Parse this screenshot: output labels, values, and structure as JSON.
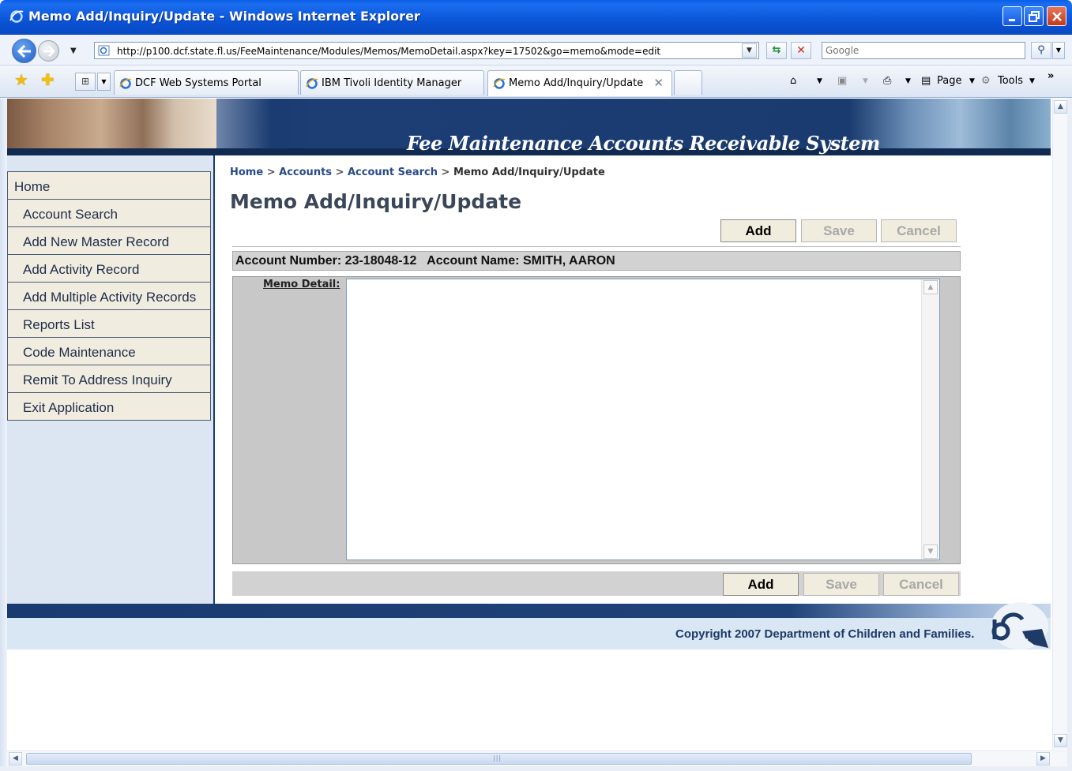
{
  "window": {
    "title": "Memo Add/Inquiry/Update - Windows Internet Explorer"
  },
  "address_bar": {
    "url": "http://p100.dcf.state.fl.us/FeeMaintenance/Modules/Memos/MemoDetail.aspx?key=17502&go=memo&mode=edit",
    "search_placeholder": "Google"
  },
  "tabs": [
    {
      "label": "DCF Web Systems Portal"
    },
    {
      "label": "IBM Tivoli Identity Manager"
    },
    {
      "label": "Memo Add/Inquiry/Update",
      "active": true
    }
  ],
  "command_bar": {
    "page_label": "Page",
    "tools_label": "Tools",
    "overflow": "»"
  },
  "banner": {
    "system_title": "Fee Maintenance Accounts Receivable System"
  },
  "nav": {
    "items": [
      {
        "label": "Home"
      },
      {
        "label": "Account Search"
      },
      {
        "label": "Add New Master Record"
      },
      {
        "label": "Add Activity Record"
      },
      {
        "label": "Add Multiple Activity Records"
      },
      {
        "label": "Reports List"
      },
      {
        "label": "Code Maintenance"
      },
      {
        "label": "Remit To Address Inquiry"
      },
      {
        "label": "Exit Application"
      }
    ]
  },
  "breadcrumb": {
    "items": [
      "Home",
      "Accounts",
      "Account Search"
    ],
    "separator": ">",
    "current": "Memo Add/Inquiry/Update"
  },
  "page": {
    "title": "Memo Add/Inquiry/Update"
  },
  "buttons": {
    "add": "Add",
    "save": "Save",
    "cancel": "Cancel"
  },
  "account": {
    "text": "Account Number: 23-18048-12   Account Name: SMITH, AARON"
  },
  "memo": {
    "label": "Memo Detail:",
    "value": ""
  },
  "footer": {
    "copyright": "Copyright 2007 Department of Children and Families."
  },
  "colors": {
    "banner": "#1c3e75",
    "nav_item_bg": "#f1ece0",
    "nav_bg": "#dbe6f2",
    "title_text": "#3b4759",
    "breadcrumb_link": "#2a4b86"
  }
}
